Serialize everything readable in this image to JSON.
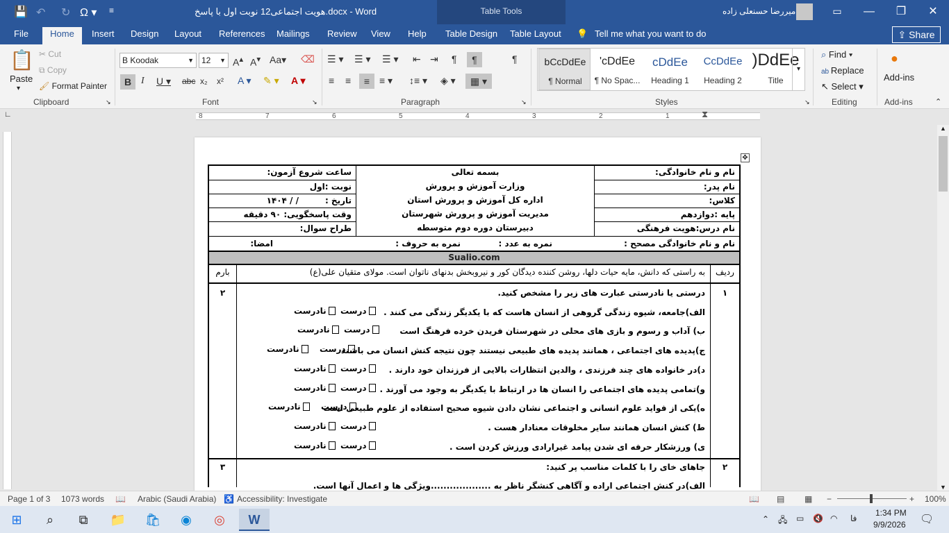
{
  "titlebar": {
    "doc_title": "هویت اجتماعی12 نوبت اول با پاسخ.docx - Word",
    "table_tools": "Table Tools",
    "user_name": "امیررضا حسنعلی زاده",
    "save_icon": "save-icon",
    "minimize": "—",
    "restore": "❐",
    "close": "✕"
  },
  "tabs": {
    "file": "File",
    "home": "Home",
    "insert": "Insert",
    "design": "Design",
    "layout": "Layout",
    "references": "References",
    "mailings": "Mailings",
    "review": "Review",
    "view": "View",
    "help": "Help",
    "table_design": "Table Design",
    "table_layout": "Table Layout",
    "tell_me": "Tell me what you want to do",
    "share": "Share"
  },
  "ribbon": {
    "clipboard": {
      "paste": "Paste",
      "cut": "Cut",
      "copy": "Copy",
      "format_painter": "Format Painter",
      "label": "Clipboard"
    },
    "font": {
      "name": "B Koodak",
      "size": "12",
      "label": "Font"
    },
    "paragraph": {
      "label": "Paragraph"
    },
    "styles": {
      "label": "Styles",
      "items": [
        {
          "preview": "bCcDdEe",
          "name": "¶ Normal"
        },
        {
          "preview": "'cDdEe",
          "name": "¶ No Spac..."
        },
        {
          "preview": "cDdEe",
          "name": "Heading 1"
        },
        {
          "preview": "CcDdEe",
          "name": "Heading 2"
        },
        {
          "preview": ")DdEe",
          "name": "Title"
        }
      ]
    },
    "editing": {
      "find": "Find",
      "replace": "Replace",
      "select": "Select",
      "label": "Editing"
    },
    "addins": {
      "button": "Add-ins",
      "label": "Add-ins"
    }
  },
  "ruler": {
    "numbers": [
      "8",
      "7",
      "6",
      "5",
      "4",
      "3",
      "2",
      "1"
    ]
  },
  "document": {
    "header": {
      "student_name": "نام و نام خانوادگی:",
      "father_name": "نام پدر:",
      "class": "کلاس:",
      "grade": "پایه :دوازدهم",
      "subject": "نام درس:هویت فرهنگی",
      "center_lines": [
        "بسمه تعالی",
        "وزارت آموزش و پرورش",
        "اداره کل آموزش و پرورش استان",
        "مدیریت آموزش و پرورش شهرستان",
        "دبیرستان دوره دوم متوسطه"
      ],
      "start_time": "ساعت شروع آزمون:",
      "term": "نوبت :اول",
      "date_label": "تاریخ :",
      "date_value": "/    /   ۱۴۰۴",
      "duration": "وقت پاسخگویی: ۹۰ دقیقه",
      "designer": "طراح سوال:",
      "corrector": "نام و نام خانوادگی مصحح :",
      "score_num": "نمره به عدد :",
      "score_text": "نمره به حروف :",
      "signature": "امضا:"
    },
    "site": "Sualio.com",
    "table_header": {
      "row": "ردیف",
      "quote": "به راستی که دانش، مایه حیات دلها، روشن کننده دیدگان کور و نیروبخش بدنهای ناتوان است. مولای متقیان علی(ع)",
      "score": "بارم"
    },
    "q1": {
      "num": "۱",
      "score": "۲",
      "title": "درستی یا نادرستی عبارت های زیر را مشخص کنید.",
      "true_label": "درست",
      "false_label": "نادرست",
      "items": [
        "الف)جامعه، شیوه زندگی گروهی از انسان هاست که با یکدیگر زندگی می کنند .",
        "ب) آداب و رسوم و بازی های محلی در شهرستان فریدن خرده فرهنگ است",
        "ج)پدیده های اجتماعی ، همانند پدیده های طبیعی نیستند چون نتیجه کنش انسان می باشند",
        "د)در خانواده های چند فرزندی ، والدین انتظارات بالایی از فرزندان خود دارند .",
        "و)تمامی پدیده های اجتماعی را انسان ها در ارتباط با یکدیگر به وجود می آورند .",
        "ه)یکی از فواید علوم انسانی و اجتماعی نشان دادن شیوه صحیح استفاده از علوم طبیعی است",
        "ط) کنش انسان همانند سایر مخلوقات معنادار هست .",
        "ی) ورزشکار حرفه ای شدن پیامد غیرارادی ورزش کردن است ."
      ]
    },
    "q2": {
      "num": "۲",
      "score": "۳",
      "title": "جاهای خای را با کلمات مناسب پر کنید:",
      "item1": "الف)در کنش اجتماعی اراده و آگاهی کنشگر ناظر به ...................ویژگی ها و اعمال آنها است."
    }
  },
  "status": {
    "page": "Page 1 of 3",
    "words": "1073 words",
    "language": "Arabic (Saudi Arabia)",
    "accessibility": "Accessibility: Investigate",
    "zoom": "100%"
  },
  "taskbar": {
    "time": "1:34 PM",
    "date": "9/9/2026",
    "lang": "فا"
  }
}
